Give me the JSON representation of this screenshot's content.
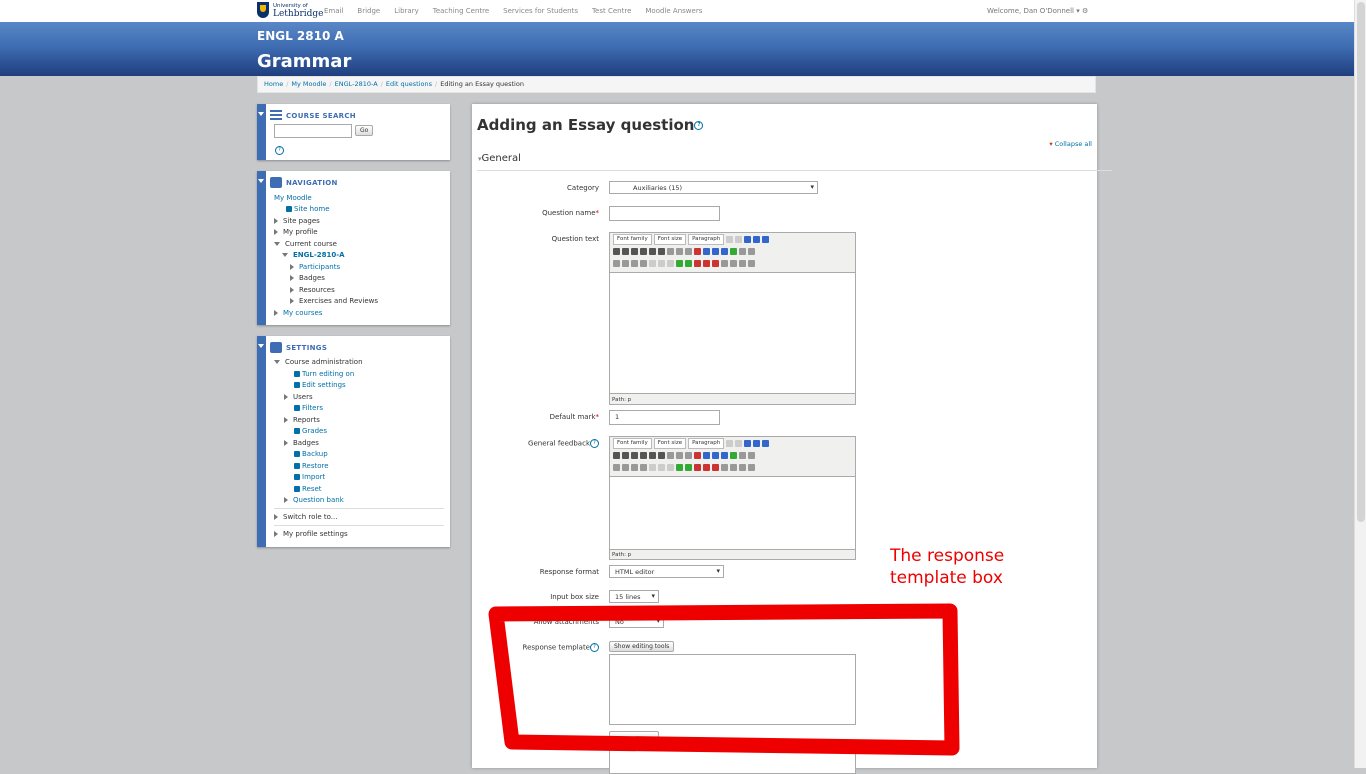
{
  "topbar": {
    "logo_top": "University of",
    "logo_bottom": "Lethbridge",
    "nav": [
      "Email",
      "Bridge",
      "Library",
      "Teaching Centre",
      "Services for Students",
      "Test Centre",
      "Moodle Answers"
    ],
    "welcome": "Welcome, Dan O'Donnell ▾ ⚙"
  },
  "header": {
    "course_code": "ENGL 2810 A",
    "course_name": "Grammar"
  },
  "breadcrumb": [
    "Home",
    "My Moodle",
    "ENGL-2810-A",
    "Edit questions",
    "Editing an Essay question"
  ],
  "course_search": {
    "title": "COURSE SEARCH",
    "button": "Go",
    "help": "?"
  },
  "navigation": {
    "title": "NAVIGATION",
    "my_moodle": "My Moodle",
    "site_home": "Site home",
    "site_pages": "Site pages",
    "my_profile": "My profile",
    "current_course": "Current course",
    "course": "ENGL-2810-A",
    "participants": "Participants",
    "badges": "Badges",
    "resources": "Resources",
    "exercises": "Exercises and Reviews",
    "my_courses": "My courses"
  },
  "settings": {
    "title": "SETTINGS",
    "course_admin": "Course administration",
    "turn_editing": "Turn editing on",
    "edit_settings": "Edit settings",
    "users": "Users",
    "filters": "Filters",
    "reports": "Reports",
    "grades": "Grades",
    "badges": "Badges",
    "backup": "Backup",
    "restore": "Restore",
    "import": "Import",
    "reset": "Reset",
    "question_bank": "Question bank",
    "switch_role": "Switch role to...",
    "my_profile_settings": "My profile settings"
  },
  "form": {
    "title": "Adding an Essay question",
    "collapse_all": "Collapse all",
    "section": "General",
    "category_label": "Category",
    "category_value": "Auxiliaries (15)",
    "question_name_label": "Question name",
    "question_text_label": "Question text",
    "font_family": "Font family",
    "font_size": "Font size",
    "paragraph": "Paragraph",
    "path": "Path: p",
    "default_mark_label": "Default mark",
    "default_mark_value": "1",
    "general_feedback_label": "General feedback",
    "response_format_label": "Response format",
    "response_format_value": "HTML editor",
    "input_box_label": "Input box size",
    "input_box_value": "15 lines",
    "allow_attachments_label": "Allow attachments",
    "allow_attachments_value": "No",
    "response_template_label": "Response template",
    "show_editing_tools": "Show editing tools"
  },
  "annotation": {
    "line1": "The response",
    "line2": "template box",
    "color": "#ee0000"
  }
}
